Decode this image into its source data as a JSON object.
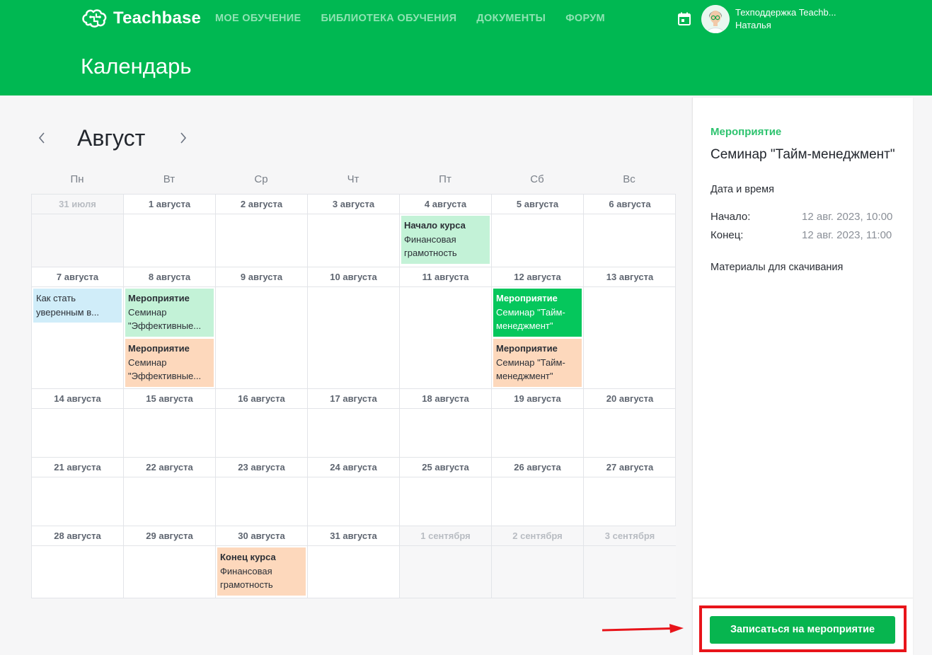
{
  "header": {
    "logo_text": "Teachbase",
    "nav": [
      "МОЕ ОБУЧЕНИЕ",
      "БИБЛИОТЕКА ОБУЧЕНИЯ",
      "ДОКУМЕНТЫ",
      "ФОРУМ"
    ],
    "user_name": "Техподдержка Teachb...",
    "user_sub": "Наталья",
    "page_title": "Календарь"
  },
  "calendar": {
    "month": "Август",
    "weekdays": [
      "Пн",
      "Вт",
      "Ср",
      "Чт",
      "Пт",
      "Сб",
      "Вс"
    ],
    "weeks": [
      {
        "days": [
          {
            "label": "31 июля",
            "out": true,
            "events": []
          },
          {
            "label": "1 августа",
            "events": []
          },
          {
            "label": "2 августа",
            "events": []
          },
          {
            "label": "3 августа",
            "events": []
          },
          {
            "label": "4 августа",
            "events": [
              {
                "title": "Начало курса",
                "sub": "Финансовая грамотность",
                "color": "green"
              }
            ]
          },
          {
            "label": "5 августа",
            "events": []
          },
          {
            "label": "6 августа",
            "events": []
          }
        ]
      },
      {
        "days": [
          {
            "label": "7 августа",
            "events": [
              {
                "title": "",
                "sub": "Как стать уверенным в...",
                "color": "blue"
              }
            ]
          },
          {
            "label": "8 августа",
            "events": [
              {
                "title": "Мероприятие",
                "sub": "Семинар \"Эффективные...",
                "color": "green"
              },
              {
                "title": "Мероприятие",
                "sub": "Семинар \"Эффективные...",
                "color": "orange"
              }
            ]
          },
          {
            "label": "9 августа",
            "events": []
          },
          {
            "label": "10 августа",
            "events": []
          },
          {
            "label": "11 августа",
            "events": []
          },
          {
            "label": "12 августа",
            "events": [
              {
                "title": "Мероприятие",
                "sub": "Семинар \"Тайм-менеджмент\"",
                "color": "active"
              },
              {
                "title": "Мероприятие",
                "sub": "Семинар \"Тайм-менеджмент\"",
                "color": "orange"
              }
            ]
          },
          {
            "label": "13 августа",
            "events": []
          }
        ]
      },
      {
        "days": [
          {
            "label": "14 августа",
            "events": []
          },
          {
            "label": "15 августа",
            "events": []
          },
          {
            "label": "16 августа",
            "events": []
          },
          {
            "label": "17 августа",
            "events": []
          },
          {
            "label": "18 августа",
            "events": []
          },
          {
            "label": "19 августа",
            "events": []
          },
          {
            "label": "20 августа",
            "events": []
          }
        ]
      },
      {
        "days": [
          {
            "label": "21 августа",
            "events": []
          },
          {
            "label": "22 августа",
            "events": []
          },
          {
            "label": "23 августа",
            "events": []
          },
          {
            "label": "24 августа",
            "events": []
          },
          {
            "label": "25 августа",
            "events": []
          },
          {
            "label": "26 августа",
            "events": []
          },
          {
            "label": "27 августа",
            "events": []
          }
        ]
      },
      {
        "days": [
          {
            "label": "28 августа",
            "events": []
          },
          {
            "label": "29 августа",
            "events": []
          },
          {
            "label": "30 августа",
            "events": [
              {
                "title": "Конец курса",
                "sub": "Финансовая грамотность",
                "color": "orange"
              }
            ]
          },
          {
            "label": "31 августа",
            "events": []
          },
          {
            "label": "1 сентября",
            "out": true,
            "events": []
          },
          {
            "label": "2 сентября",
            "out": true,
            "events": []
          },
          {
            "label": "3 сентября",
            "out": true,
            "events": []
          }
        ]
      }
    ]
  },
  "panel": {
    "type": "Мероприятие",
    "title": "Семинар \"Тайм-менеджмент\"",
    "datetime_heading": "Дата и время",
    "start_label": "Начало:",
    "start_value": "12 авг. 2023, 10:00",
    "end_label": "Конец:",
    "end_value": "12 авг. 2023, 11:00",
    "materials_heading": "Материалы для скачивания",
    "register_button": "Записаться на мероприятие"
  },
  "colors": {
    "brand": "#00b852",
    "event_green": "#c3f2d7",
    "event_orange": "#fdd8bc",
    "event_blue": "#d0edf9",
    "event_active": "#05c75c",
    "highlight": "#e8141a"
  }
}
